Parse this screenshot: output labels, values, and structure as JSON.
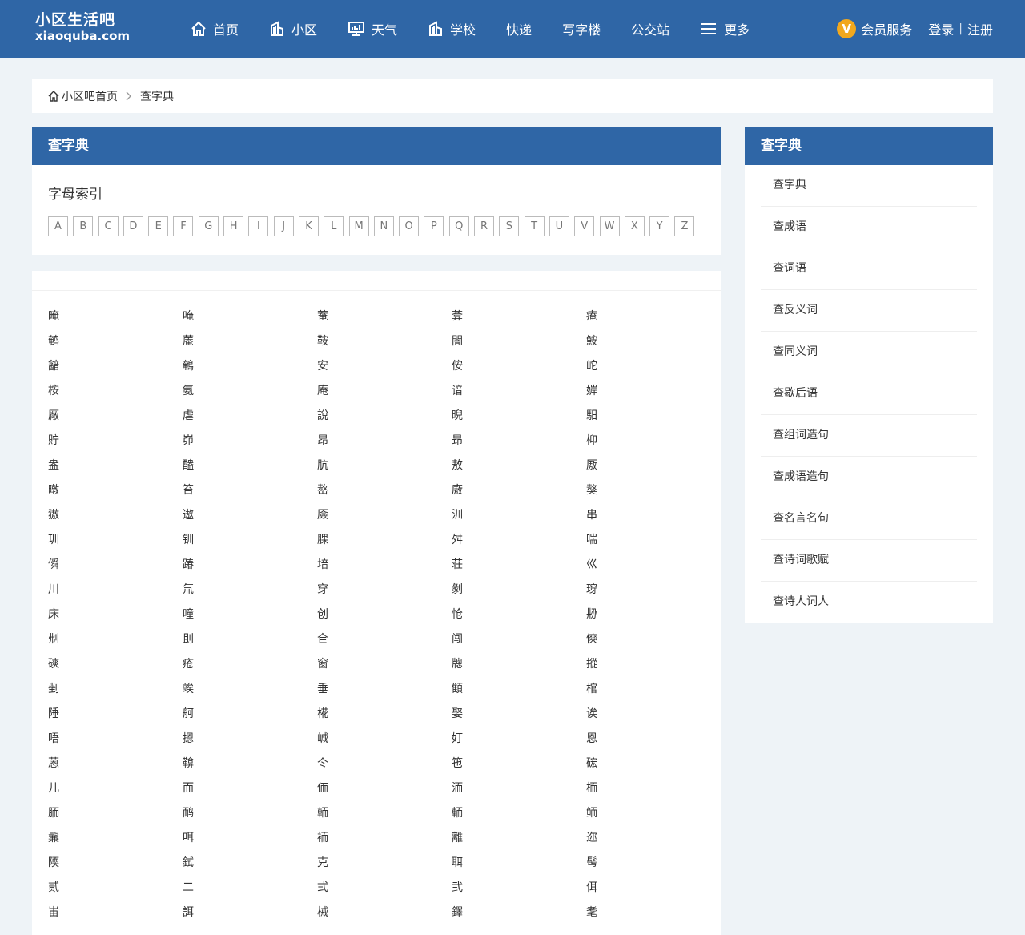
{
  "header": {
    "logo_cn": "小区生活吧",
    "logo_en": "xiaoquba.com",
    "nav": [
      {
        "label": "首页",
        "icon": "home-icon"
      },
      {
        "label": "小区",
        "icon": "building-icon"
      },
      {
        "label": "天气",
        "icon": "monitor-chart-icon"
      },
      {
        "label": "学校",
        "icon": "school-icon"
      },
      {
        "label": "快递",
        "icon": ""
      },
      {
        "label": "写字楼",
        "icon": ""
      },
      {
        "label": "公交站",
        "icon": ""
      },
      {
        "label": "更多",
        "icon": "menu-icon"
      }
    ],
    "vip_badge": "V",
    "vip_label": "会员服务",
    "login": "登录",
    "separator": "|",
    "register": "注册",
    "accent": "#2f66a6",
    "vip_color": "#f2a81d"
  },
  "breadcrumb": {
    "home": "小区吧首页",
    "current": "查字典"
  },
  "main": {
    "title": "查字典",
    "index_title": "字母索引",
    "letters": [
      "A",
      "B",
      "C",
      "D",
      "E",
      "F",
      "G",
      "H",
      "I",
      "J",
      "K",
      "L",
      "M",
      "N",
      "O",
      "P",
      "Q",
      "R",
      "S",
      "T",
      "U",
      "V",
      "W",
      "X",
      "Y",
      "Z"
    ],
    "chars": [
      "晻",
      "唵",
      "菴",
      "葊",
      "痷",
      "鹌",
      "蓭",
      "鞍",
      "闇",
      "鮟",
      "韽",
      "鵪",
      "安",
      "侒",
      "岮",
      "桉",
      "氨",
      "庵",
      "谙",
      "婩",
      "厰",
      "虐",
      "說",
      "晲",
      "馹",
      "貯",
      "峁",
      "昂",
      "昻",
      "枊",
      "盎",
      "醠",
      "肮",
      "敖",
      "厫",
      "暾",
      "笞",
      "嶅",
      "廒",
      "獒",
      "獓",
      "遨",
      "厱",
      "汌",
      "串",
      "玔",
      "钏",
      "腂",
      "舛",
      "喘",
      "僢",
      "踳",
      "堷",
      "荘",
      "巛",
      "川",
      "氚",
      "穿",
      "剶",
      "瑏",
      "床",
      "噇",
      "创",
      "怆",
      "刱",
      "刜",
      "刞",
      "仺",
      "闯",
      "傸",
      "磢",
      "疮",
      "窗",
      "牕",
      "摐",
      "剉",
      "竢",
      "垂",
      "顀",
      "棺",
      "陲",
      "舸",
      "椛",
      "娶",
      "诶",
      "唔",
      "摁",
      "峸",
      "奵",
      "恩",
      "蒽",
      "鞥",
      "仒",
      "竾",
      "硡",
      "儿",
      "而",
      "侕",
      "洏",
      "栭",
      "胹",
      "鸸",
      "輀",
      "輀",
      "鲕",
      "鬑",
      "咡",
      "袻",
      "離",
      "迩",
      "陾",
      "鉽",
      "克",
      "聑",
      "髩",
      "贰",
      "二",
      "弍",
      "弐",
      "佴",
      "峀",
      "誀",
      "械",
      "鐸",
      "耄"
    ]
  },
  "sidebar": {
    "title": "查字典",
    "items": [
      "查字典",
      "查成语",
      "查词语",
      "查反义词",
      "查同义词",
      "查歇后语",
      "查组词造句",
      "查成语造句",
      "查名言名句",
      "查诗词歌赋",
      "查诗人词人"
    ]
  }
}
